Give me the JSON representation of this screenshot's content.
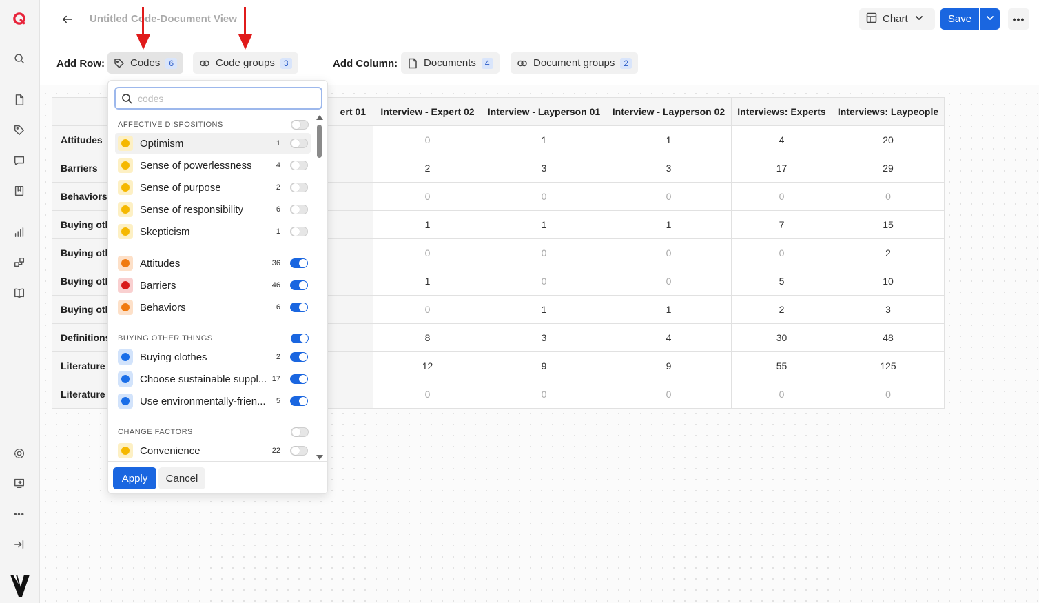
{
  "app": {
    "logo": "brand-q-icon",
    "brand_color": "#e8233a",
    "accent_color": "#1a66e0"
  },
  "sidebar": {
    "top_icons": [
      "search-icon",
      "document-icon",
      "tag-icon",
      "comment-icon",
      "bookmark-icon",
      "bar-chart-icon",
      "network-icon",
      "book-icon"
    ],
    "bottom_icons": [
      "gear-icon",
      "export-icon",
      "more-icon",
      "collapse-icon",
      "v-logo-icon"
    ]
  },
  "header": {
    "title": "Untitled Code-Document View",
    "chart_label": "Chart",
    "save_label": "Save",
    "more_label": "•••"
  },
  "toolbar": {
    "add_row_label": "Add Row:",
    "add_column_label": "Add Column:",
    "codes": {
      "label": "Codes",
      "count": "6"
    },
    "code_groups": {
      "label": "Code groups",
      "count": "3"
    },
    "documents": {
      "label": "Documents",
      "count": "4"
    },
    "document_groups": {
      "label": "Document groups",
      "count": "2"
    }
  },
  "table": {
    "columns": [
      "ert 01",
      "Interview - Expert 02",
      "Interview - Layperson 01",
      "Interview - Layperson 02",
      "Interviews: Experts",
      "Interviews: Laypeople"
    ],
    "rows": [
      {
        "label": "Attitudes",
        "values": [
          "",
          "0",
          "1",
          "1",
          "4",
          "20"
        ]
      },
      {
        "label": "Barriers",
        "values": [
          "",
          "2",
          "3",
          "3",
          "17",
          "29"
        ]
      },
      {
        "label": "Behaviors",
        "values": [
          "",
          "0",
          "0",
          "0",
          "0",
          "0"
        ]
      },
      {
        "label": "Buying oth",
        "values": [
          "",
          "1",
          "1",
          "1",
          "7",
          "15"
        ]
      },
      {
        "label": "Buying oth",
        "values": [
          "",
          "0",
          "0",
          "0",
          "0",
          "2"
        ]
      },
      {
        "label": "Buying oth",
        "values": [
          "",
          "1",
          "0",
          "0",
          "5",
          "10"
        ]
      },
      {
        "label": "Buying oth",
        "values": [
          "",
          "0",
          "1",
          "1",
          "2",
          "3"
        ]
      },
      {
        "label": "Definitions",
        "values": [
          "",
          "8",
          "3",
          "4",
          "30",
          "48"
        ]
      },
      {
        "label": "Literature r",
        "values": [
          "",
          "12",
          "9",
          "9",
          "55",
          "125"
        ]
      },
      {
        "label": "Literature r",
        "values": [
          "",
          "0",
          "0",
          "0",
          "0",
          "0"
        ]
      }
    ]
  },
  "popup": {
    "search_placeholder": "codes",
    "groups": [
      {
        "title": "AFFECTIVE DISPOSITIONS",
        "on": false
      },
      {
        "title": "BUYING OTHER THINGS",
        "on": true
      },
      {
        "title": "CHANGE FACTORS",
        "on": false
      }
    ],
    "items": [
      {
        "name": "Optimism",
        "count": "1",
        "on": false,
        "color": "#f5b800",
        "bg": "#fdf0c4"
      },
      {
        "name": "Sense of powerlessness",
        "count": "4",
        "on": false,
        "color": "#f5b800",
        "bg": "#fdf0c4"
      },
      {
        "name": "Sense of purpose",
        "count": "2",
        "on": false,
        "color": "#f5b800",
        "bg": "#fdf0c4"
      },
      {
        "name": "Sense of responsibility",
        "count": "6",
        "on": false,
        "color": "#f5b800",
        "bg": "#fdf0c4"
      },
      {
        "name": "Skepticism",
        "count": "1",
        "on": false,
        "color": "#f5b800",
        "bg": "#fdf0c4"
      },
      {
        "name": "Attitudes",
        "count": "36",
        "on": true,
        "color": "#f07a10",
        "bg": "#fde0c8"
      },
      {
        "name": "Barriers",
        "count": "46",
        "on": true,
        "color": "#d81b1b",
        "bg": "#f9d0d0"
      },
      {
        "name": "Behaviors",
        "count": "6",
        "on": true,
        "color": "#f07a10",
        "bg": "#fde0c8"
      },
      {
        "name": "Buying clothes",
        "count": "2",
        "on": true,
        "color": "#1a6ee8",
        "bg": "#d2e3fb"
      },
      {
        "name": "Choose sustainable suppl...",
        "count": "17",
        "on": true,
        "color": "#1a6ee8",
        "bg": "#d2e3fb"
      },
      {
        "name": "Use environmentally-frien...",
        "count": "5",
        "on": true,
        "color": "#1a6ee8",
        "bg": "#d2e3fb"
      },
      {
        "name": "Convenience",
        "count": "22",
        "on": false,
        "color": "#f5b800",
        "bg": "#fdf0c4"
      }
    ],
    "apply_label": "Apply",
    "cancel_label": "Cancel"
  },
  "annotations": {
    "arrow_color": "#e01b1b"
  }
}
